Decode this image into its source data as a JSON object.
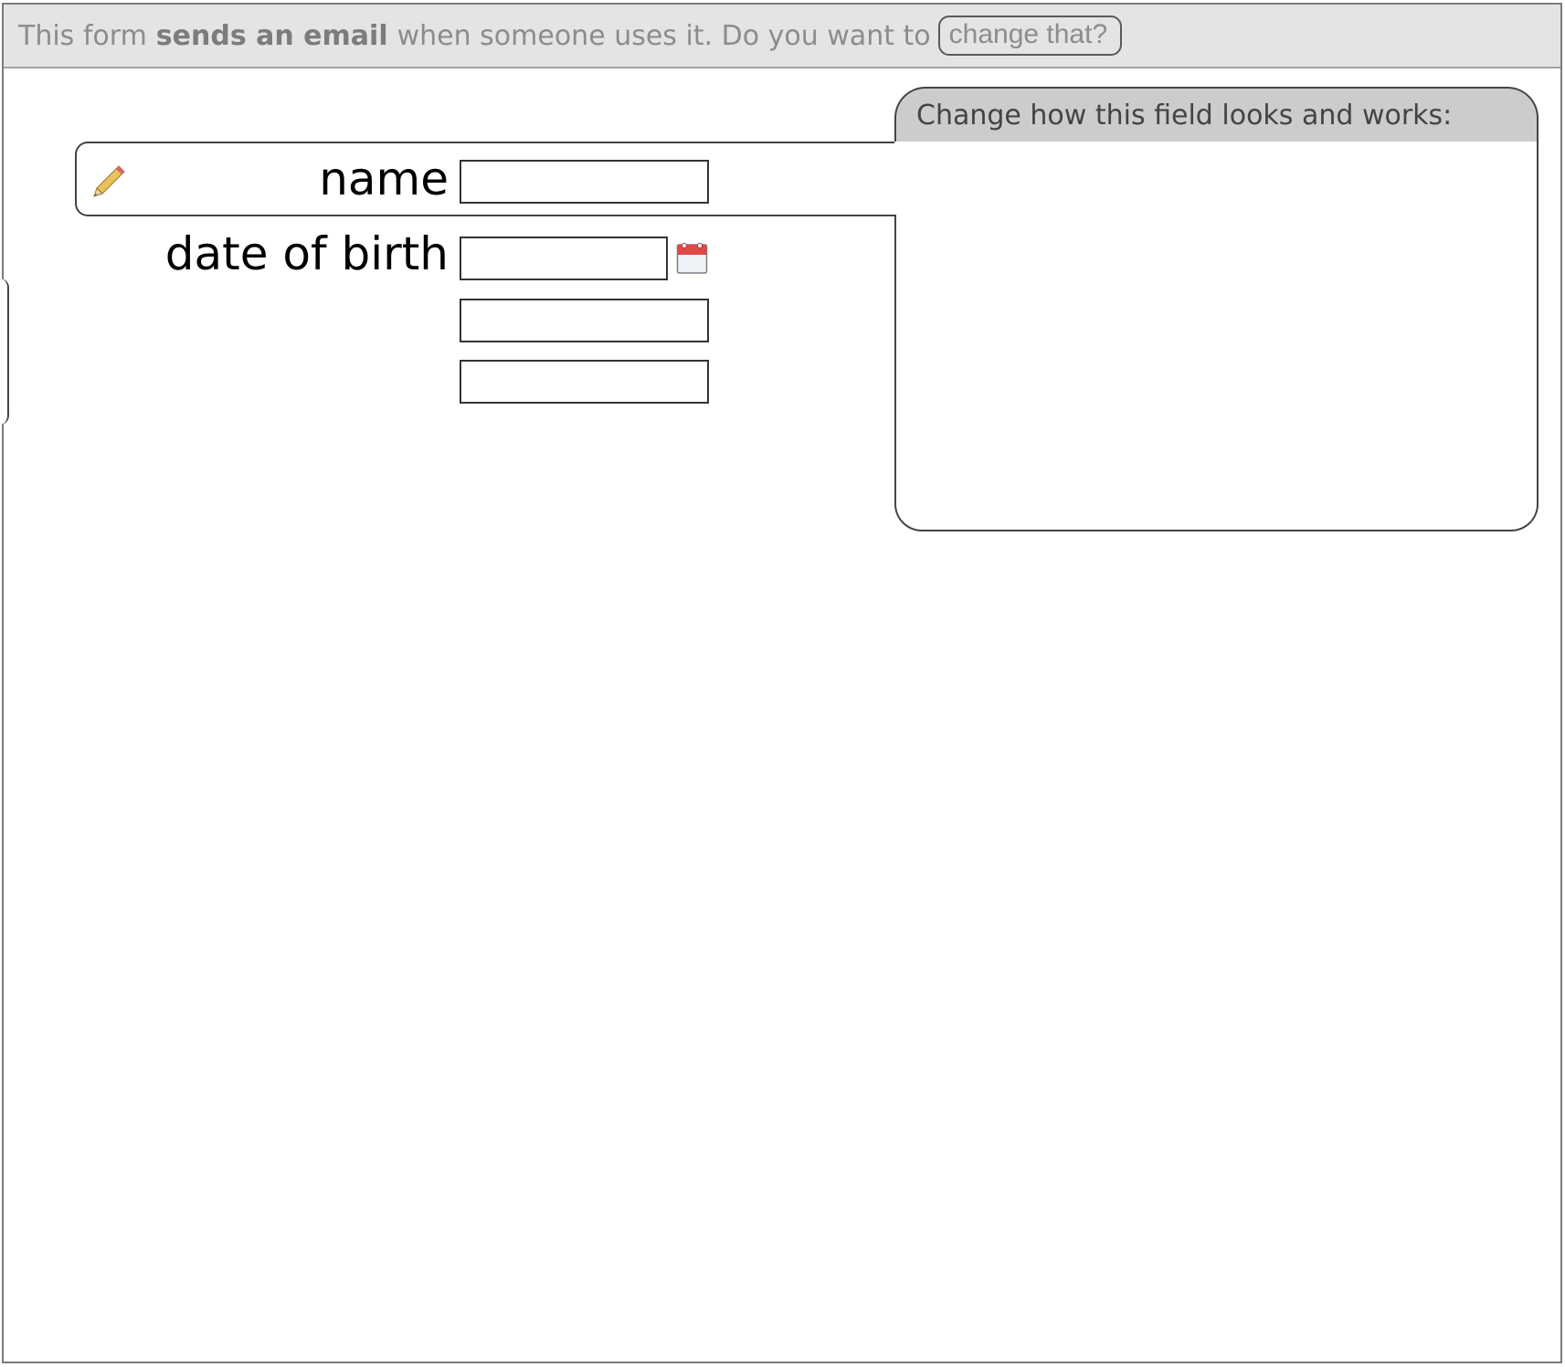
{
  "notice": {
    "prefix": "This form",
    "emphasis": "sends an email",
    "suffix": "when someone uses it. Do you want to",
    "change_button": "change that?"
  },
  "editor": {
    "title": "Change how this field looks and works:"
  },
  "form": {
    "fields": [
      {
        "label": "name",
        "value": ""
      },
      {
        "label": "date of birth",
        "value": ""
      },
      {
        "label": "",
        "value": ""
      },
      {
        "label": "",
        "value": ""
      }
    ]
  },
  "icons": {
    "edit": "pencil-icon",
    "date_picker": "calendar-icon"
  },
  "colors": {
    "notice_bar": "#e4e4e4",
    "editor_tab": "#cccccc",
    "calendar_accent": "#e04848"
  }
}
